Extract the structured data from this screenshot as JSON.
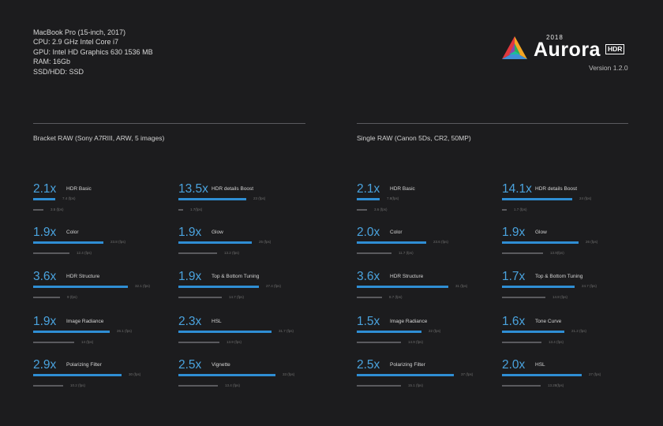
{
  "specs": [
    "MacBook Pro (15-inch, 2017)",
    "CPU: 2.9 GHz Intel Core i7",
    "GPU: Intel HD Graphics 630 1536 MB",
    "RAM: 16Gb",
    "SSD/HDD: SSD"
  ],
  "logo": {
    "year": "2018",
    "word": "Aurora",
    "badge": "HDR"
  },
  "version": "Version 1.2.0",
  "colors": {
    "accent": "#4aa3de",
    "bar_new": "#2f8ed4",
    "bar_old": "#5a5a5e",
    "background": "#1c1c1e"
  },
  "chart_data": [
    {
      "type": "bar",
      "title": "Bracket RAW (Sony A7RIII, ARW, 5 images)",
      "series": [
        {
          "values": [
            7.4,
            23.8,
            32.1,
            26.1,
            30,
            23,
            25,
            27.4,
            31.7,
            33
          ]
        },
        {
          "values": [
            3.5,
            12.4,
            9,
            14,
            10.2,
            1.7,
            13.2,
            14.7,
            13.9,
            13.4
          ]
        }
      ],
      "items": [
        {
          "factor": "2.1x",
          "label": "HDR Basic",
          "fps_new": "7.4 (fps)",
          "fps_old": "3.5 (fps)",
          "new": 7.4,
          "old": 3.5
        },
        {
          "factor": "1.9x",
          "label": "Color",
          "fps_new": "23.8 (fps)",
          "fps_old": "12.4 (fps)",
          "new": 23.8,
          "old": 12.4
        },
        {
          "factor": "3.6x",
          "label": "HDR Structure",
          "fps_new": "32.1 (fps)",
          "fps_old": "9 (fps)",
          "new": 32.1,
          "old": 9
        },
        {
          "factor": "1.9x",
          "label": "Image Radiance",
          "fps_new": "26.1 (fps)",
          "fps_old": "14 (fps)",
          "new": 26.1,
          "old": 14
        },
        {
          "factor": "2.9x",
          "label": "Polarizing Filter",
          "fps_new": "30 (fps)",
          "fps_old": "10.2 (fps)",
          "new": 30,
          "old": 10.2
        },
        {
          "factor": "13.5x",
          "label": "HDR details Boost",
          "fps_new": "23 (fps)",
          "fps_old": "1.7(fps)",
          "new": 23,
          "old": 1.7
        },
        {
          "factor": "1.9x",
          "label": "Glow",
          "fps_new": "25 (fps)",
          "fps_old": "13.2 (fps)",
          "new": 25,
          "old": 13.2
        },
        {
          "factor": "1.9x",
          "label": "Top & Bottom Tuning",
          "fps_new": "27.4 (fps)",
          "fps_old": "14.7 (fps)",
          "new": 27.4,
          "old": 14.7
        },
        {
          "factor": "2.3x",
          "label": "HSL",
          "fps_new": "31.7 (fps)",
          "fps_old": "13.9 (fps)",
          "new": 31.7,
          "old": 13.9
        },
        {
          "factor": "2.5x",
          "label": "Vignette",
          "fps_new": "33 (fps)",
          "fps_old": "13.4 (fps)",
          "new": 33,
          "old": 13.4
        }
      ]
    },
    {
      "type": "bar",
      "title": "Single RAW (Canon 5Ds, CR2, 50MP)",
      "series": [
        {
          "values": [
            7.8,
            23.6,
            31,
            22,
            37,
            24,
            26,
            24.7,
            21.2,
            27
          ]
        },
        {
          "values": [
            3.6,
            11.7,
            8.7,
            14.9,
            15.1,
            1.7,
            13.9,
            14.8,
            13.4,
            13.28
          ]
        }
      ],
      "items": [
        {
          "factor": "2.1x",
          "label": "HDR Basic",
          "fps_new": "7.8(fps)",
          "fps_old": "3.6 (fps)",
          "new": 7.8,
          "old": 3.6
        },
        {
          "factor": "2.0x",
          "label": "Color",
          "fps_new": "23.6 (fps)",
          "fps_old": "11.7 (fps)",
          "new": 23.6,
          "old": 11.7
        },
        {
          "factor": "3.6x",
          "label": "HDR Structure",
          "fps_new": "31 (fps)",
          "fps_old": "8.7 (fps)",
          "new": 31,
          "old": 8.7
        },
        {
          "factor": "1.5x",
          "label": "Image Radiance",
          "fps_new": "22 (fps)",
          "fps_old": "14.9 (fps)",
          "new": 22,
          "old": 14.9
        },
        {
          "factor": "2.5x",
          "label": "Polarizing Filter",
          "fps_new": "37 (fps)",
          "fps_old": "15.1 (fps)",
          "new": 37,
          "old": 15.1
        },
        {
          "factor": "14.1x",
          "label": "HDR details Boost",
          "fps_new": "24 (fps)",
          "fps_old": "1.7 (fps)",
          "new": 24,
          "old": 1.7
        },
        {
          "factor": "1.9x",
          "label": "Glow",
          "fps_new": "26 (fps)",
          "fps_old": "13.9(fps)",
          "new": 26,
          "old": 13.9
        },
        {
          "factor": "1.7x",
          "label": "Top & Bottom Tuning",
          "fps_new": "24.7 (fps)",
          "fps_old": "14.8 (fps)",
          "new": 24.7,
          "old": 14.8
        },
        {
          "factor": "1.6x",
          "label": "Tone Curve",
          "fps_new": "21.2 (fps)",
          "fps_old": "13.4 (fps)",
          "new": 21.2,
          "old": 13.4
        },
        {
          "factor": "2.0x",
          "label": "HSL",
          "fps_new": "27 (fps)",
          "fps_old": "13.28(fps)",
          "new": 27,
          "old": 13.28
        }
      ]
    }
  ]
}
